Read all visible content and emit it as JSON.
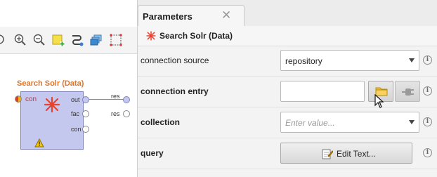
{
  "process": {
    "operator": {
      "title": "Search Solr (Data)",
      "input_port": "con",
      "output_ports": [
        "out",
        "fac",
        "con"
      ]
    },
    "result_ports": [
      "res",
      "res"
    ]
  },
  "parameters_panel": {
    "tab_label": "Parameters",
    "operator_name": "Search Solr (Data)",
    "rows": [
      {
        "label": "connection source",
        "value": "repository"
      },
      {
        "label": "connection entry",
        "value": ""
      },
      {
        "label": "collection",
        "placeholder": "Enter value..."
      },
      {
        "label": "query",
        "button_label": "Edit Text..."
      }
    ]
  },
  "icons": {
    "toolbar": [
      "zoom-in-icon",
      "zoom-out-icon",
      "add-note-icon",
      "auto-wire-icon",
      "layers-icon",
      "select-all-icon"
    ],
    "operator": "solr-icon",
    "warning": "warning-icon",
    "folder": "folder-icon",
    "plug": "plug-icon",
    "info": "info-icon",
    "edit": "edit-icon"
  },
  "colors": {
    "operator_title": "#e0752a",
    "operator_body": "#c4c8ee",
    "input_port_label": "#cc3333"
  }
}
